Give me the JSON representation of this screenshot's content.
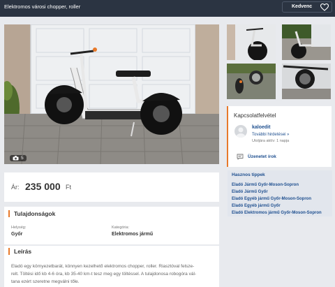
{
  "header": {
    "title": "Elektromos városi chopper, roller",
    "favorite_label": "Kedvenc"
  },
  "gallery": {
    "photo_count": "5"
  },
  "price": {
    "label": "Ár:",
    "value": "235 000",
    "currency": "Ft"
  },
  "properties": {
    "title": "Tulajdonságok",
    "location_label": "Helység:",
    "location_value": "Győr",
    "category_label": "Kategória:",
    "category_value": "Elektromos jármű"
  },
  "description": {
    "title": "Leírás",
    "line1": "Eladó egy környezetbarát, könnyen kezelhető elektromos chopper, roller. Riasztóval felsze-",
    "line2": "relt. Töltési idő kb 4-6 óra, kb 35-40 km-t tesz meg egy töltéssel. A tulajdonosa robogóra vál-",
    "line3": "tana ezért szeretne megválni tőle."
  },
  "contact": {
    "title": "Kapcsolatfelvétel",
    "username": "kaloedit",
    "more_ads": "További hirdetései »",
    "last_active": "Utoljára aktív: 1 napja",
    "message_label": "Üzenetet írok"
  },
  "tips": {
    "title": "Hasznos tippek",
    "links": [
      "Eladó Jármű Győr-Moson-Sopron",
      "Eladó Jármű Győr",
      "Eladó Egyéb jármű Győr-Moson-Sopron",
      "Eladó Egyéb jármű Győr",
      "Eladó Elektromos jármű Győr-Moson-Sopron"
    ]
  },
  "colors": {
    "header_bg": "#2b3442",
    "link": "#1e4f8f",
    "accent": "#e8792a"
  },
  "icons": [
    "heart-icon",
    "camera-icon",
    "message-icon",
    "avatar-placeholder"
  ]
}
